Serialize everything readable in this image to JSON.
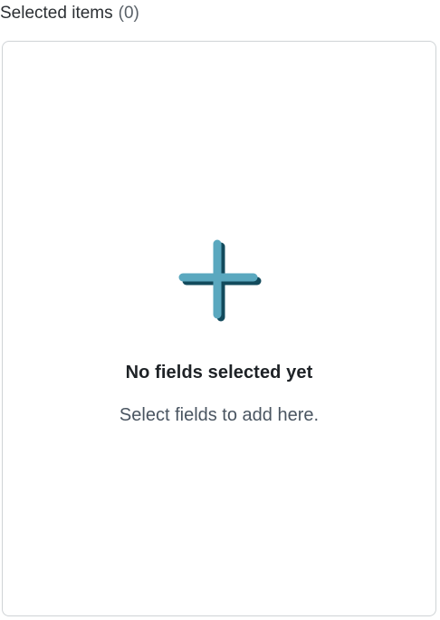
{
  "header": {
    "title": "Selected items",
    "count": "(0)"
  },
  "empty_state": {
    "icon": "plus-icon",
    "title": "No fields selected yet",
    "subtitle": "Select fields to add here."
  },
  "colors": {
    "icon_fill": "#5aa8bf",
    "icon_shadow": "#124a5c",
    "border": "#cfd3d6"
  }
}
